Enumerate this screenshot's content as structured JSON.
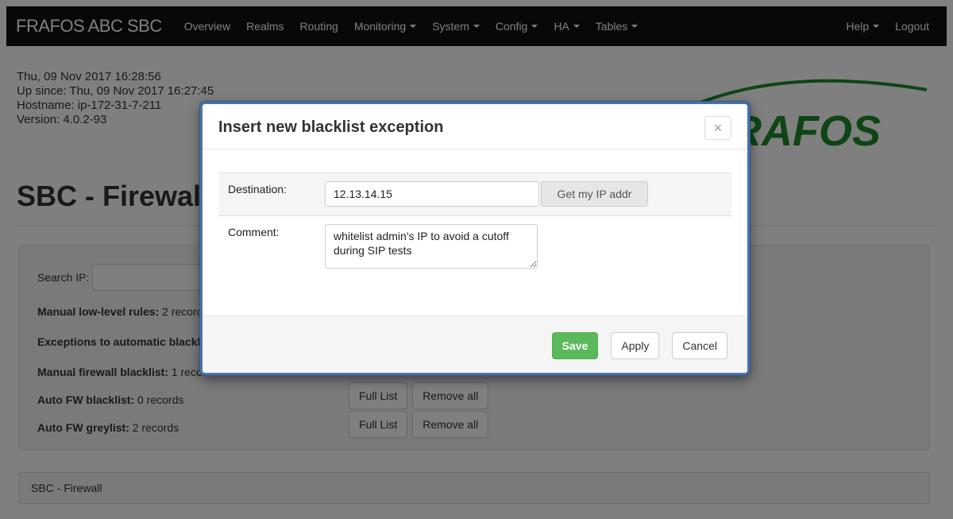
{
  "navbar": {
    "brand": "FRAFOS ABC SBC",
    "items": [
      {
        "label": "Overview",
        "dropdown": false
      },
      {
        "label": "Realms",
        "dropdown": false
      },
      {
        "label": "Routing",
        "dropdown": false
      },
      {
        "label": "Monitoring",
        "dropdown": true
      },
      {
        "label": "System",
        "dropdown": true
      },
      {
        "label": "Config",
        "dropdown": true
      },
      {
        "label": "HA",
        "dropdown": true
      },
      {
        "label": "Tables",
        "dropdown": true
      }
    ],
    "right_items": [
      {
        "label": "Help",
        "dropdown": true
      },
      {
        "label": "Logout",
        "dropdown": false
      }
    ]
  },
  "sysinfo": {
    "date": "Thu, 09 Nov 2017 16:28:56",
    "uptime": "Up since: Thu, 09 Nov 2017 16:27:45",
    "hostname": "Hostname: ip-172-31-7-211",
    "version": "Version: 4.0.2-93"
  },
  "logo": {
    "text": "FRAFOS",
    "color": "#1f8a2a"
  },
  "page": {
    "title": "SBC - Firewall",
    "search_label": "Search IP:",
    "stats": [
      {
        "label": "Manual low-level rules:",
        "value": "2 records"
      },
      {
        "label": "Exceptions to automatic blacklisting:",
        "value": ""
      },
      {
        "label": "Manual firewall blacklist:",
        "value": "1 records"
      },
      {
        "label": "Auto FW blacklist:",
        "value": "0 records"
      },
      {
        "label": "Auto FW greylist:",
        "value": "2 records"
      }
    ],
    "full_list_label": "Full List",
    "remove_all_label": "Remove all",
    "footer": "SBC - Firewall"
  },
  "modal": {
    "title": "Insert new blacklist exception",
    "close": "×",
    "destination_label": "Destination:",
    "destination_value": "12.13.14.15",
    "get_ip_label": "Get my IP addr",
    "comment_label": "Comment:",
    "comment_value": "whitelist admin's IP to avoid a cutoff during SIP tests",
    "save_label": "Save",
    "apply_label": "Apply",
    "cancel_label": "Cancel"
  },
  "colors": {
    "navbar_bg": "#101010",
    "save_green": "#5cb85c",
    "modal_border": "#4a73a8"
  }
}
